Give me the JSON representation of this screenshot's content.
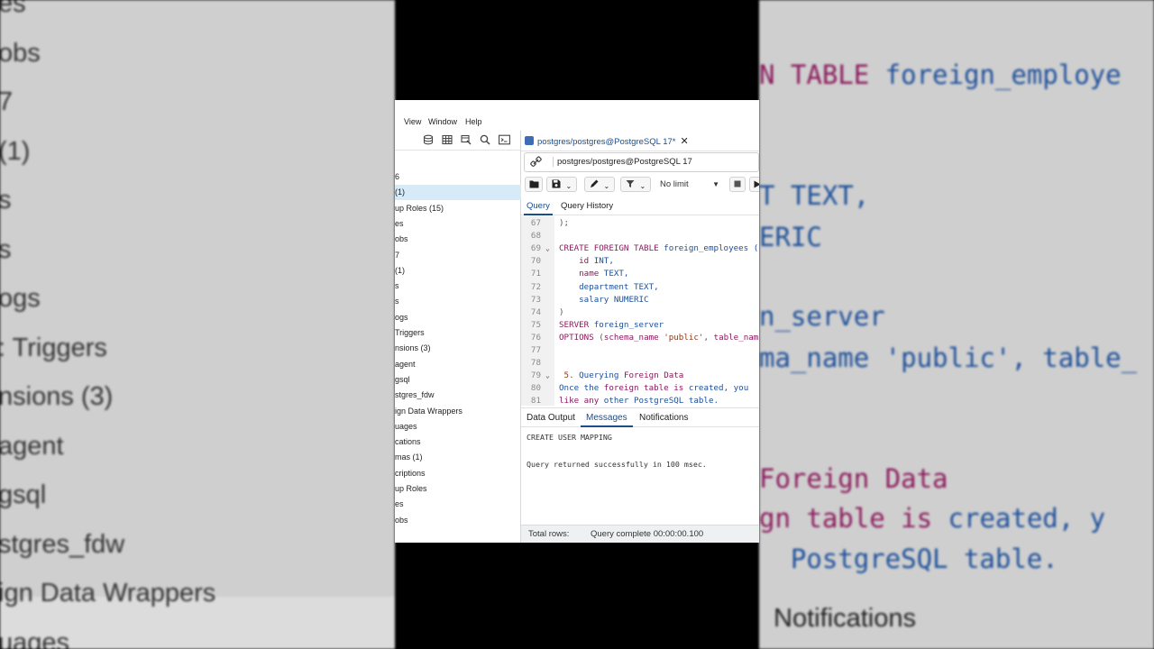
{
  "background_left": {
    "items": [
      "es",
      "obs",
      "7",
      "(1)",
      "s",
      "s",
      "ogs",
      ": Triggers",
      "nsions (3)",
      "agent",
      "gsql",
      "stgres_fdw",
      "ign Data Wrappers",
      "uages"
    ]
  },
  "background_right": {
    "lines": [
      {
        "kw": "N TABLE",
        "tx": " foreign_employe"
      },
      {
        "kw": "",
        "tx": "T TEXT,"
      },
      {
        "kw": "",
        "tx": "ERIC"
      },
      {
        "kw": "",
        "tx": "n_server"
      },
      {
        "kw": "",
        "tx": "ma_name 'public', table_"
      },
      {
        "kw": "Foreign Data",
        "tx": ""
      },
      {
        "kw": "gn table is",
        "tx": " created, y"
      },
      {
        "kw": "",
        "tx": "  PostgreSQL table."
      }
    ],
    "notifications": "Notifications"
  },
  "menu": {
    "items": [
      "View",
      "Window",
      "Help"
    ]
  },
  "tree": {
    "items": [
      {
        "label": "6"
      },
      {
        "label": "(1)",
        "selected": true
      },
      {
        "label": "up Roles (15)"
      },
      {
        "label": "es"
      },
      {
        "label": "obs"
      },
      {
        "label": "7"
      },
      {
        "label": "(1)"
      },
      {
        "label": "s"
      },
      {
        "label": "s"
      },
      {
        "label": "ogs"
      },
      {
        "label": "Triggers"
      },
      {
        "label": "nsions (3)"
      },
      {
        "label": "agent"
      },
      {
        "label": "gsql"
      },
      {
        "label": "stgres_fdw"
      },
      {
        "label": "ign Data Wrappers"
      },
      {
        "label": "uages"
      },
      {
        "label": "cations"
      },
      {
        "label": "mas (1)"
      },
      {
        "label": "criptions"
      },
      {
        "label": "up Roles"
      },
      {
        "label": "es"
      },
      {
        "label": "obs"
      }
    ]
  },
  "query_tab": {
    "title": "postgres/postgres@PostgreSQL 17*",
    "close": "✕"
  },
  "connection": {
    "label": "postgres/postgres@PostgreSQL 17"
  },
  "toolbar": {
    "limit_label": "No limit"
  },
  "subtabs": [
    "Query",
    "Query History"
  ],
  "editor": {
    "lines": [
      {
        "n": "67",
        "parts": [
          {
            "c": "pn",
            "t": ");"
          }
        ]
      },
      {
        "n": "68",
        "parts": []
      },
      {
        "n": "69",
        "fold": true,
        "parts": [
          {
            "c": "kw",
            "t": "CREATE FOREIGN TABLE"
          },
          {
            "c": "tx",
            "t": " foreign_employees ("
          }
        ]
      },
      {
        "n": "70",
        "parts": [
          {
            "c": "kw",
            "t": "    id"
          },
          {
            "c": "tx",
            "t": " INT,"
          }
        ]
      },
      {
        "n": "71",
        "parts": [
          {
            "c": "kw",
            "t": "    name"
          },
          {
            "c": "tx",
            "t": " TEXT,"
          }
        ]
      },
      {
        "n": "72",
        "parts": [
          {
            "c": "tx",
            "t": "    department TEXT,"
          }
        ]
      },
      {
        "n": "73",
        "parts": [
          {
            "c": "tx",
            "t": "    salary NUMERIC"
          }
        ]
      },
      {
        "n": "74",
        "parts": [
          {
            "c": "pn",
            "t": ")"
          }
        ]
      },
      {
        "n": "75",
        "parts": [
          {
            "c": "kw",
            "t": "SERVER"
          },
          {
            "c": "tx",
            "t": " foreign_server"
          }
        ]
      },
      {
        "n": "76",
        "parts": [
          {
            "c": "kw",
            "t": "OPTIONS"
          },
          {
            "c": "pn",
            "t": " ("
          },
          {
            "c": "kw",
            "t": "schema_name"
          },
          {
            "c": "str",
            "t": " 'public'"
          },
          {
            "c": "pn",
            "t": ","
          },
          {
            "c": "kw",
            "t": " table_name"
          }
        ]
      },
      {
        "n": "77",
        "parts": []
      },
      {
        "n": "78",
        "parts": []
      },
      {
        "n": "79",
        "fold": true,
        "parts": [
          {
            "c": "str",
            "t": " 5. "
          },
          {
            "c": "tx",
            "t": "Querying "
          },
          {
            "c": "kw",
            "t": "Foreign Data"
          }
        ]
      },
      {
        "n": "80",
        "parts": [
          {
            "c": "tx",
            "t": "Once the "
          },
          {
            "c": "kw",
            "t": "foreign table is"
          },
          {
            "c": "tx",
            "t": " created, you"
          }
        ]
      },
      {
        "n": "81",
        "parts": [
          {
            "c": "kw",
            "t": "like any"
          },
          {
            "c": "tx",
            "t": " other PostgreSQL table."
          }
        ]
      }
    ]
  },
  "output_tabs": [
    "Data Output",
    "Messages",
    "Notifications"
  ],
  "messages": {
    "line1": "CREATE USER MAPPING",
    "line2": "Query returned successfully in 100 msec."
  },
  "status": {
    "total_rows": "Total rows:",
    "complete": "Query complete 00:00:00.100"
  }
}
